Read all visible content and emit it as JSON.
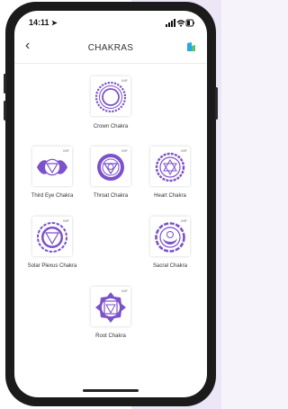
{
  "status": {
    "time": "14:11"
  },
  "header": {
    "title": "CHAKRAS"
  },
  "chakras": [
    {
      "name": "Crown Chakra",
      "badge": "IMF"
    },
    {
      "name": "Third Eye Chakra",
      "badge": "IMF"
    },
    {
      "name": "Throat Chakra",
      "badge": "IMF"
    },
    {
      "name": "Heart Chakra",
      "badge": "IMF"
    },
    {
      "name": "Solar Plexus Chakra",
      "badge": "IMF"
    },
    {
      "name": "Sacral Chakra",
      "badge": "IMF"
    },
    {
      "name": "Root Chakra",
      "badge": "IMF"
    }
  ],
  "colors": {
    "accent": "#7b52c9",
    "badge_blue": "#29a8e0",
    "badge_green": "#5cc36b"
  },
  "icons": [
    "back-chevron-icon",
    "location-arrow-icon",
    "signal-icon",
    "wifi-icon",
    "battery-icon",
    "app-badge-icon"
  ]
}
